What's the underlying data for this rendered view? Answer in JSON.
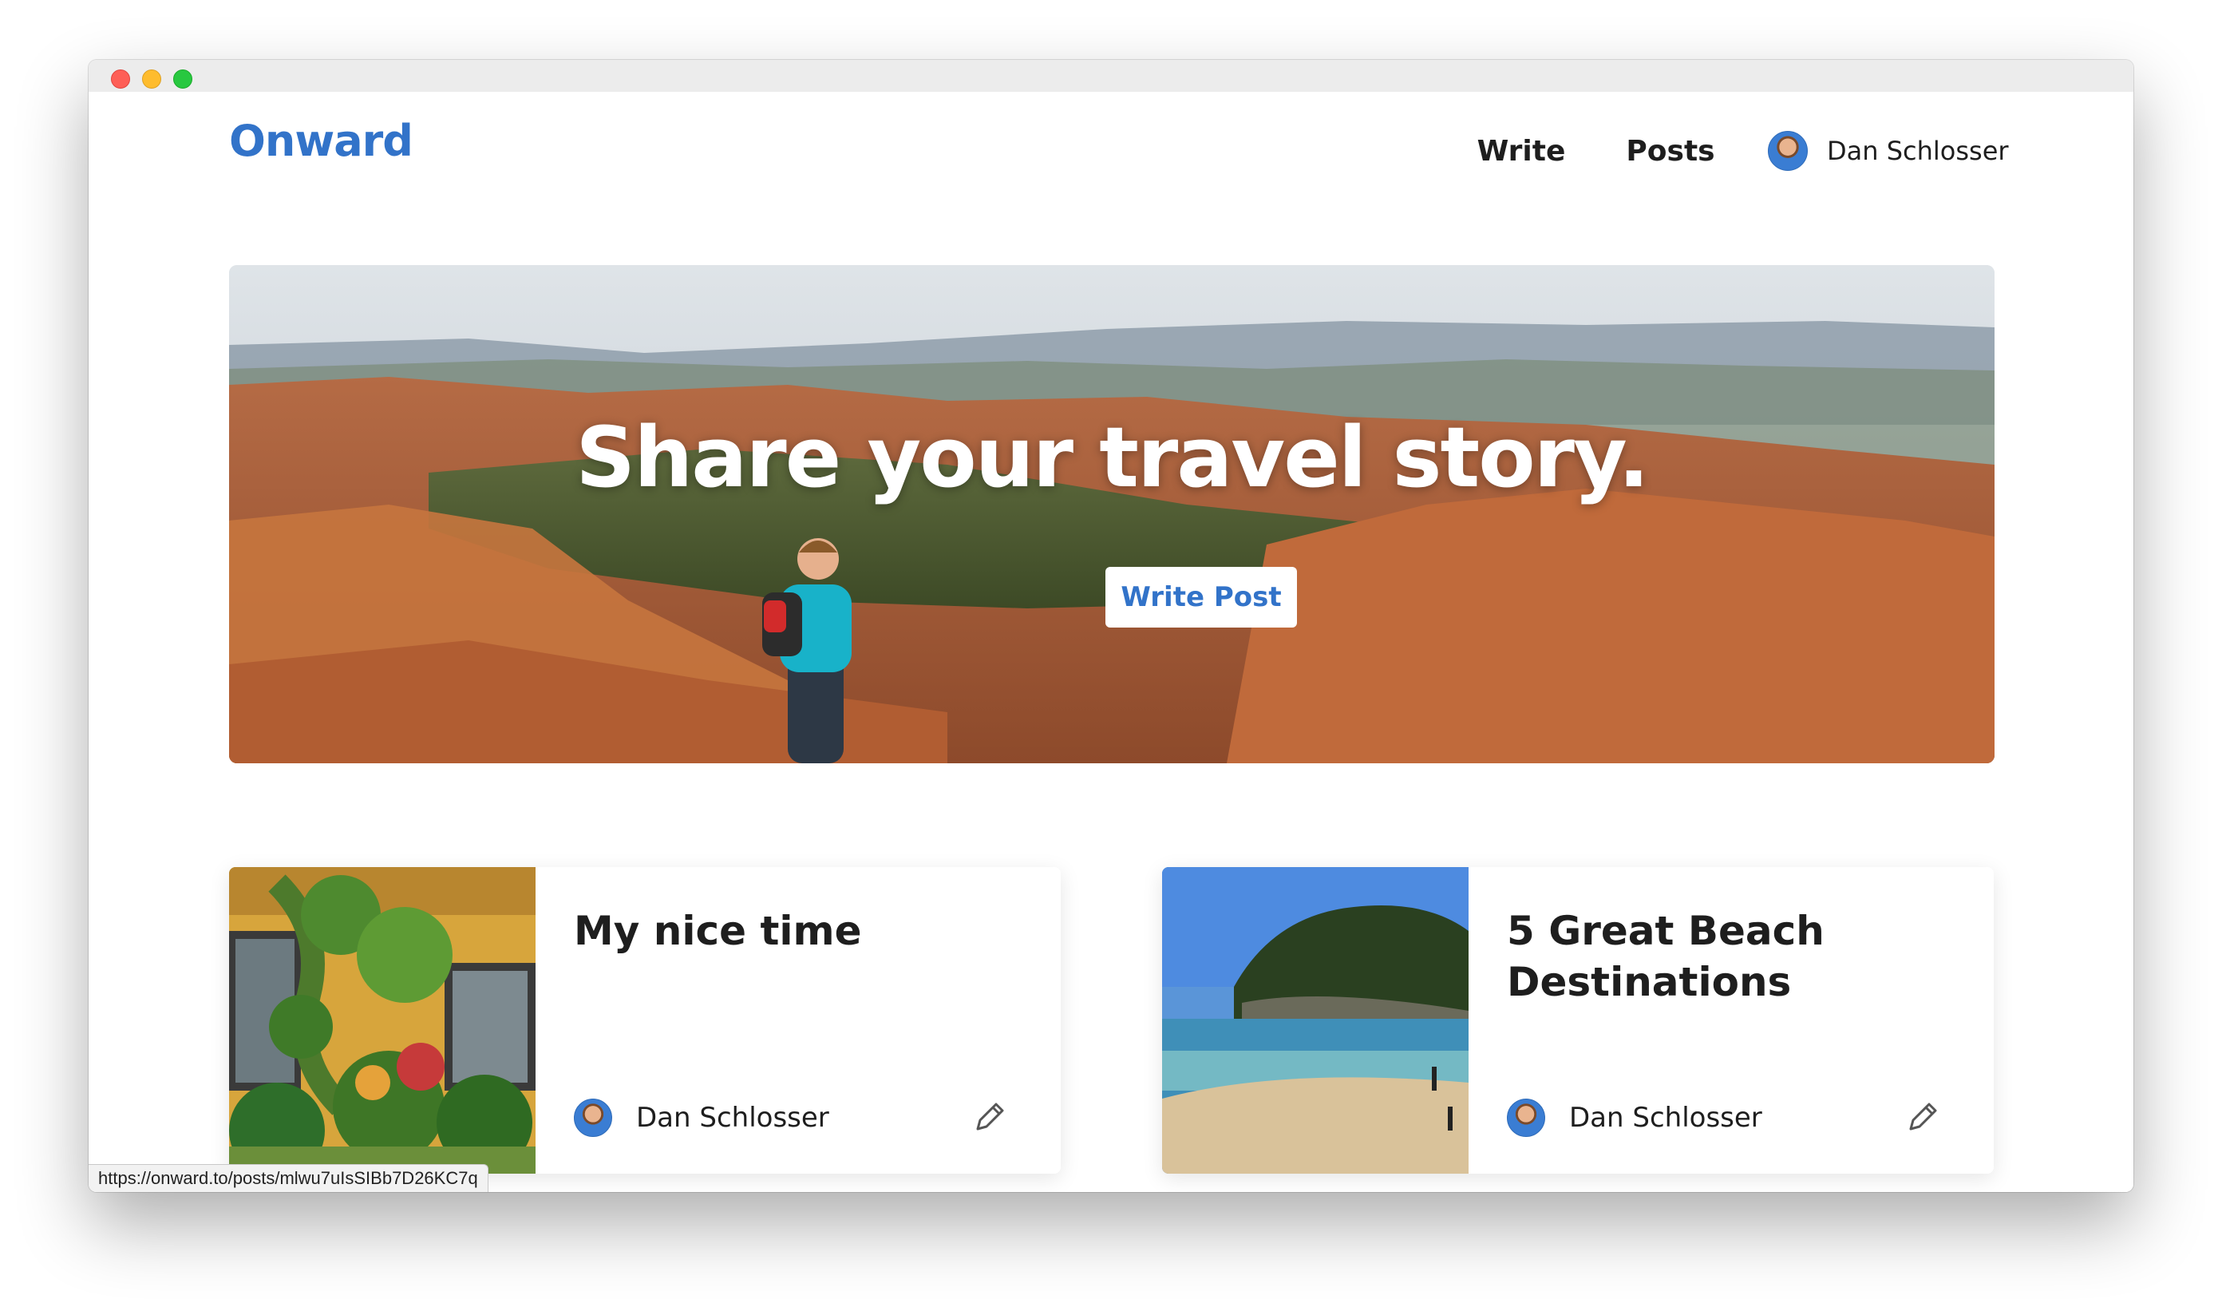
{
  "window": {
    "controls": [
      "close",
      "minimize",
      "maximize"
    ]
  },
  "header": {
    "logo": "Onward",
    "nav": {
      "write": "Write",
      "posts": "Posts"
    },
    "user": {
      "name": "Dan Schlosser"
    }
  },
  "hero": {
    "title": "Share your travel story.",
    "cta": "Write Post"
  },
  "posts": [
    {
      "title": "My nice time",
      "author": "Dan Schlosser",
      "image": "garden-wall-photo"
    },
    {
      "title": "5 Great Beach Destinations",
      "author": "Dan Schlosser",
      "image": "beach-photo"
    }
  ],
  "status_url": "https://onward.to/posts/mlwu7uIsSIBb7D26KC7q",
  "colors": {
    "brand": "#3273c9",
    "write_highlight": "#fcebd0",
    "posts_highlight": "#eeeeee"
  }
}
